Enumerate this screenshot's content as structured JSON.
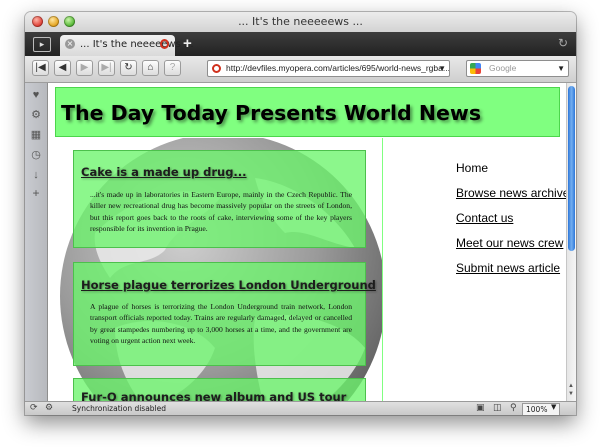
{
  "window": {
    "title": "... It's the neeeeews ..."
  },
  "tab": {
    "label": "... It's the neeeeews ..."
  },
  "address_bar": {
    "url": "http://devfiles.myopera.com/articles/695/world-news_rgba..."
  },
  "search_box": {
    "placeholder": "Google",
    "engine_icon": "google-icon"
  },
  "toolbar_icons": [
    "rewind-icon",
    "back-icon",
    "forward-icon",
    "fast-forward-icon",
    "reload-icon",
    "home-icon",
    "info-icon"
  ],
  "side_panel_icons": [
    "heart-icon",
    "gear-icon",
    "notes-icon",
    "history-icon",
    "download-icon",
    "add-icon"
  ],
  "page": {
    "header_title": "The Day Today Presents World News",
    "articles": [
      {
        "title": "Cake is a made up drug...",
        "body": "...it's made up in laboratories in Eastern Europe, mainly in the Czech Republic. The killer new recreational drug has become massively popular on the streets of London, but this report goes back to the roots of cake, interviewing some of the key players responsible for its invention in Prague."
      },
      {
        "title": "Horse plague terrorizes London Underground",
        "body": "A plague of horses is terrorizing the London Underground train network, London transport officials reported today. Trains are regularly damaged, delayed or cancelled by great stampedes numbering up to 3,000 horses at a time, and the government are voting on urgent action next week."
      },
      {
        "title": "Fur-Q announces new album and US tour",
        "body": ""
      }
    ],
    "nav": [
      "Home",
      "Browse news archives",
      "Contact us",
      "Meet our news crew",
      "Submit news article"
    ]
  },
  "status": {
    "text": "Synchronization disabled",
    "zoom": "100%"
  },
  "colors": {
    "header_bg": "#80ff80",
    "article_bg": "#6cf56c",
    "scroll_thumb": "#2c76d8"
  }
}
